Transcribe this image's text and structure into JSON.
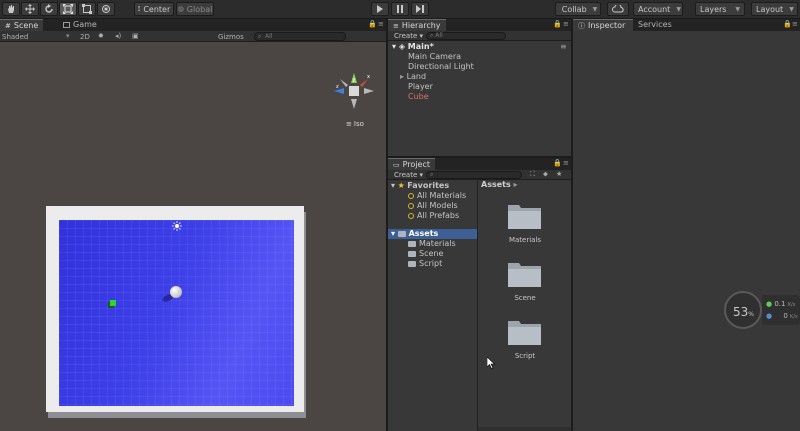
{
  "toolbar": {
    "pivot_label": "Center",
    "space_label": "Global",
    "collab_label": "Collab",
    "account_label": "Account",
    "layers_label": "Layers",
    "layout_label": "Layout"
  },
  "scene": {
    "tabs": [
      {
        "label": "Scene"
      },
      {
        "label": "Game"
      }
    ],
    "shading_mode": "Shaded",
    "mode_2d": "2D",
    "gizmos_label": "Gizmos",
    "search_placeholder": "All",
    "projection_label": "Iso"
  },
  "hierarchy": {
    "title": "Hierarchy",
    "create_label": "Create",
    "search_placeholder": "All",
    "scene_name": "Main*",
    "objects": [
      {
        "label": "Main Camera"
      },
      {
        "label": "Directional Light"
      },
      {
        "label": "Land"
      },
      {
        "label": "Player"
      },
      {
        "label": "Cube"
      }
    ]
  },
  "project": {
    "title": "Project",
    "create_label": "Create",
    "favorites_label": "Favorites",
    "favorites": [
      {
        "label": "All Materials"
      },
      {
        "label": "All Models"
      },
      {
        "label": "All Prefabs"
      }
    ],
    "assets_label": "Assets",
    "asset_children": [
      {
        "label": "Materials"
      },
      {
        "label": "Scene"
      },
      {
        "label": "Script"
      }
    ],
    "breadcrumb": "Assets",
    "grid_items": [
      {
        "label": "Materials"
      },
      {
        "label": "Scene"
      },
      {
        "label": "Script"
      }
    ]
  },
  "inspector": {
    "tabs": [
      {
        "label": "Inspector"
      },
      {
        "label": "Services"
      }
    ]
  },
  "perf": {
    "percent": "53",
    "unit": "%",
    "upload": "0.1",
    "upload_unit": "K/s",
    "download": "0",
    "download_unit": "K/s"
  },
  "colors": {
    "selection": "#3e5f96",
    "floor": "#3a3ae6",
    "cube": "#2ad82a",
    "missing_object": "#dd6f6f"
  }
}
